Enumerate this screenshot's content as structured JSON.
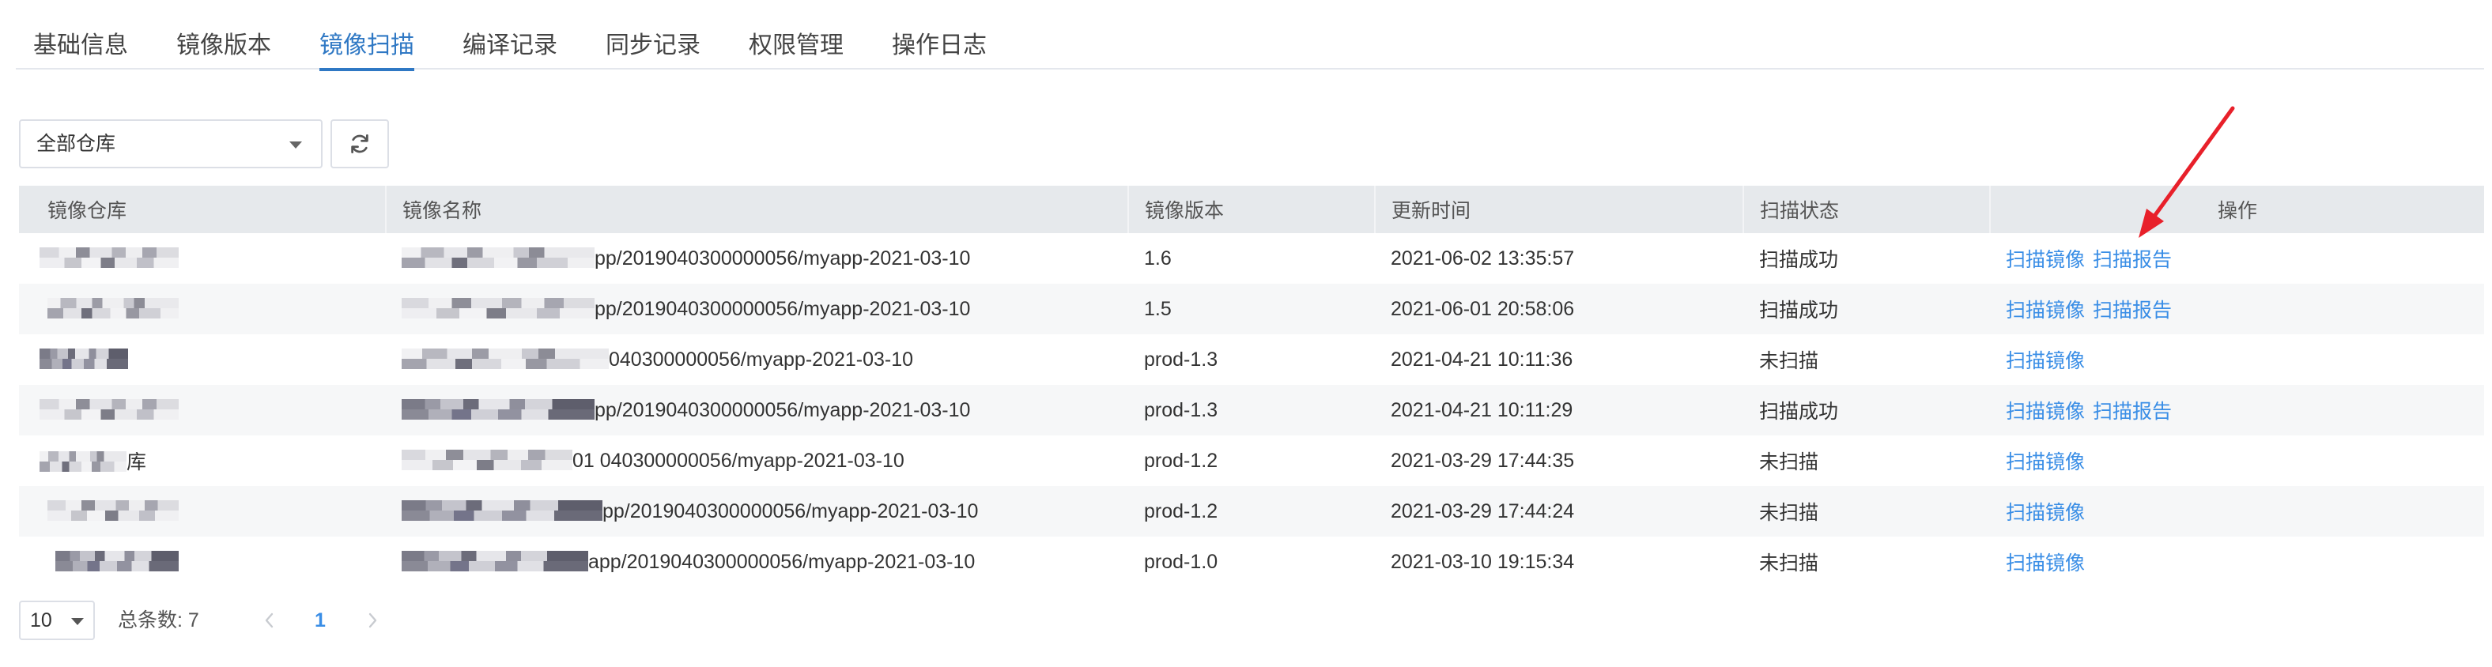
{
  "tabs": [
    {
      "label": "基础信息"
    },
    {
      "label": "镜像版本"
    },
    {
      "label": "镜像扫描",
      "active": true
    },
    {
      "label": "编译记录"
    },
    {
      "label": "同步记录"
    },
    {
      "label": "权限管理"
    },
    {
      "label": "操作日志"
    }
  ],
  "toolbar": {
    "repository_select": {
      "value": "全部仓库",
      "icon": "chevron-down-icon"
    },
    "refresh_button": {
      "icon": "refresh-icon"
    }
  },
  "table": {
    "headers": [
      "镜像仓库",
      "镜像名称",
      "镜像版本",
      "更新时间",
      "扫描状态",
      "操作"
    ],
    "rows": [
      {
        "name_visible": "pp/2019040300000056/myapp-2021-03-10",
        "version": "1.6",
        "updated": "2021-06-02 13:35:57",
        "status": "扫描成功",
        "actions": [
          "扫描镜像",
          "扫描报告"
        ]
      },
      {
        "name_visible": "pp/2019040300000056/myapp-2021-03-10",
        "version": "1.5",
        "updated": "2021-06-01 20:58:06",
        "status": "扫描成功",
        "actions": [
          "扫描镜像",
          "扫描报告"
        ]
      },
      {
        "name_visible": "040300000056/myapp-2021-03-10",
        "version": "prod-1.3",
        "updated": "2021-04-21 10:11:36",
        "status": "未扫描",
        "actions": [
          "扫描镜像"
        ]
      },
      {
        "name_visible": "pp/2019040300000056/myapp-2021-03-10",
        "version": "prod-1.3",
        "updated": "2021-04-21 10:11:29",
        "status": "扫描成功",
        "actions": [
          "扫描镜像",
          "扫描报告"
        ]
      },
      {
        "repository_visible": "库",
        "name_visible": "01 040300000056/myapp-2021-03-10",
        "version": "prod-1.2",
        "updated": "2021-03-29 17:44:35",
        "status": "未扫描",
        "actions": [
          "扫描镜像"
        ]
      },
      {
        "name_visible": "pp/2019040300000056/myapp-2021-03-10",
        "version": "prod-1.2",
        "updated": "2021-03-29 17:44:24",
        "status": "未扫描",
        "actions": [
          "扫描镜像"
        ]
      },
      {
        "name_visible": "app/2019040300000056/myapp-2021-03-10",
        "version": "prod-1.0",
        "updated": "2021-03-10 19:15:34",
        "status": "未扫描",
        "actions": [
          "扫描镜像"
        ]
      }
    ]
  },
  "pagination": {
    "page_size": "10",
    "total_label": "总条数: 7",
    "current_page": "1",
    "prev_icon": "chevron-left-icon",
    "next_icon": "chevron-right-icon"
  },
  "annotation": {
    "type": "arrow",
    "color": "#e8202a"
  },
  "colors": {
    "accent": "#2f78c4",
    "link": "#3a8ee6",
    "header_bg": "#e6e9ec",
    "stripe_bg": "#f6f7f8"
  }
}
